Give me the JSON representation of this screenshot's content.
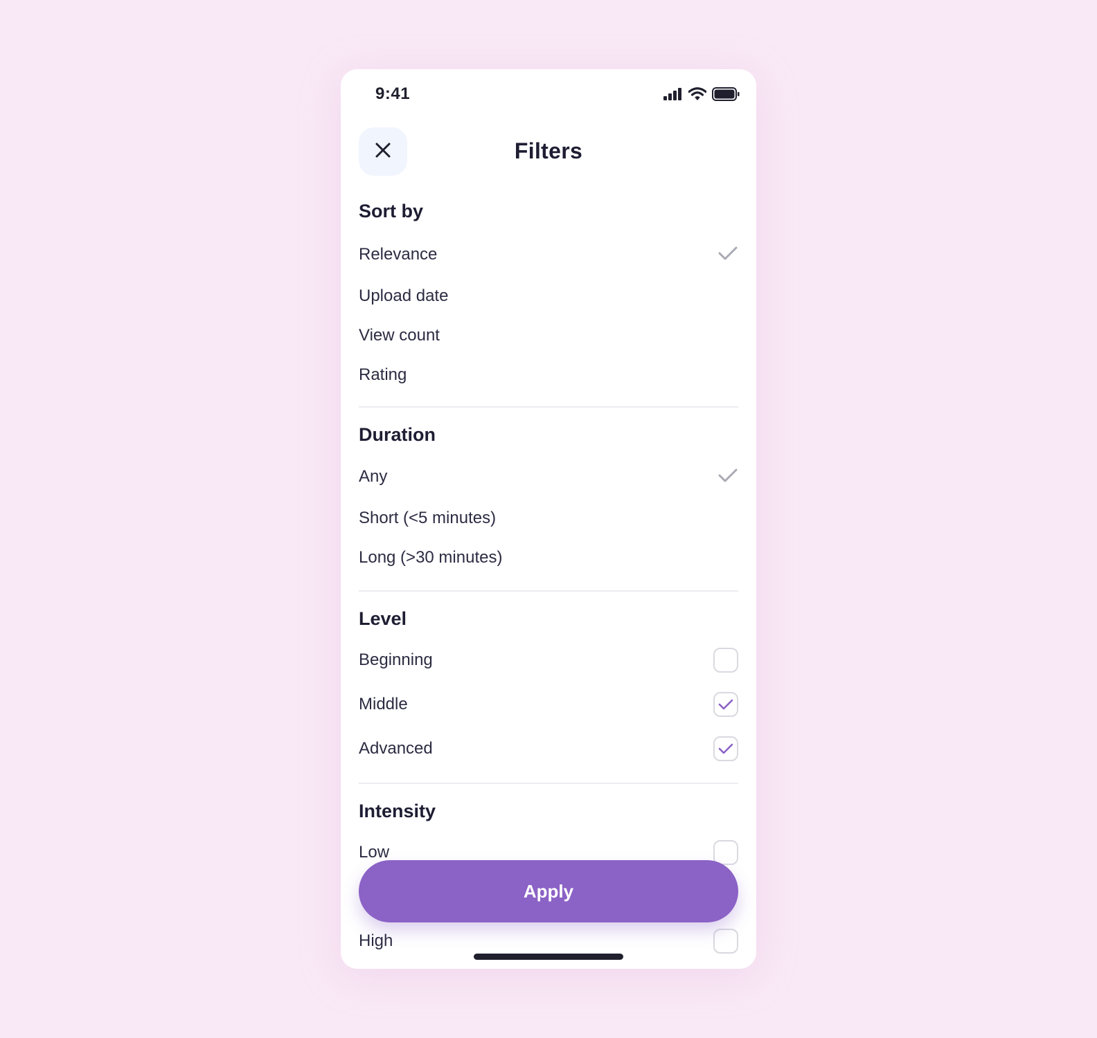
{
  "status_bar": {
    "time": "9:41",
    "icons": [
      "cellular-signal-icon",
      "wifi-icon",
      "battery-icon"
    ]
  },
  "header": {
    "title": "Filters",
    "close_icon": "close-icon"
  },
  "sections": {
    "sort_by": {
      "title": "Sort by",
      "options": [
        "Relevance",
        "Upload date",
        "View count",
        "Rating"
      ],
      "selected": "Relevance"
    },
    "duration": {
      "title": "Duration",
      "options": [
        "Any",
        "Short (<5 minutes)",
        "Long (>30 minutes)"
      ],
      "selected": "Any"
    },
    "level": {
      "title": "Level",
      "options": [
        {
          "label": "Beginning",
          "checked": false
        },
        {
          "label": "Middle",
          "checked": true
        },
        {
          "label": "Advanced",
          "checked": true
        }
      ]
    },
    "intensity": {
      "title": "Intensity",
      "options": [
        {
          "label": "Low",
          "checked": false
        },
        {
          "label": "High",
          "checked": false
        }
      ]
    }
  },
  "apply_button": {
    "label": "Apply"
  },
  "colors": {
    "background": "#f9e9f6",
    "accent": "#8b62c6",
    "selected_check": "#a9a9b3",
    "checkbox_border": "#d9d9e0",
    "text_dark": "#1e1d33",
    "close_button_bg": "#f1f5fd"
  }
}
